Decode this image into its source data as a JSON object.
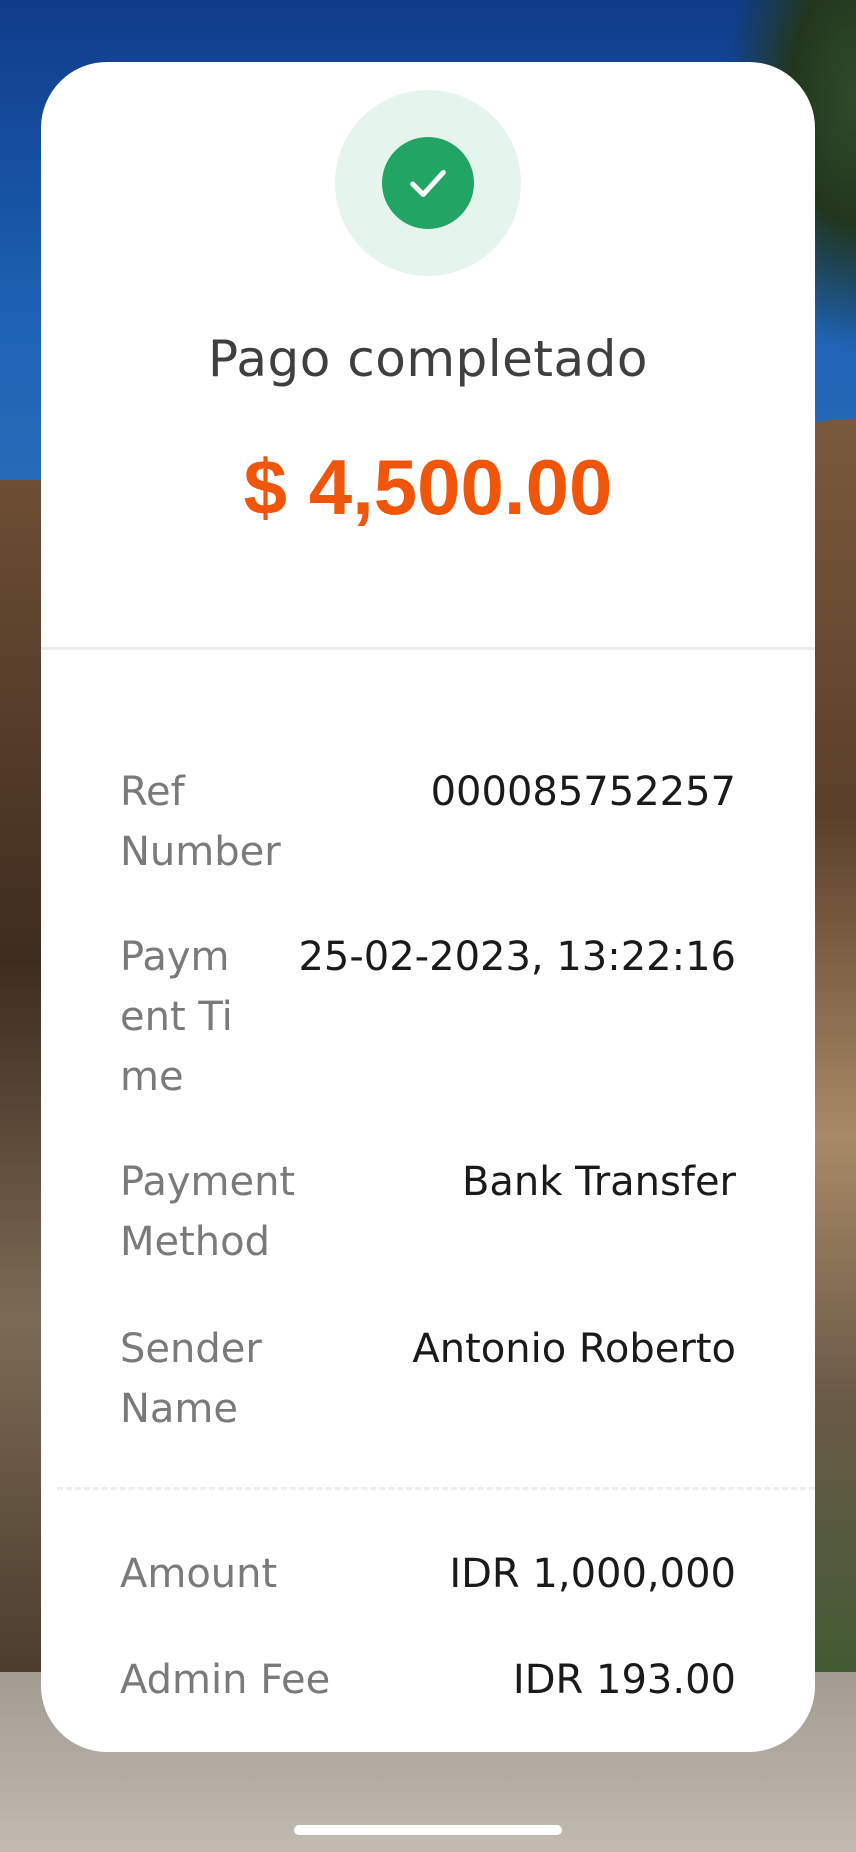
{
  "status": {
    "title": "Pago completado",
    "amount": "$ 4,500.00",
    "icon": "check-icon",
    "colors": {
      "success": "#22a464",
      "success_halo": "#e5f4ec",
      "amount": "#f0550a"
    }
  },
  "details": [
    {
      "label": "Ref Number",
      "value": "000085752257"
    },
    {
      "label": "Payment Time",
      "value": "25-02-2023, 13:22:16"
    },
    {
      "label": "Payment Method",
      "value": "Bank Transfer"
    },
    {
      "label": "Sender Name",
      "value": "Antonio Roberto"
    }
  ],
  "summary": [
    {
      "label": "Amount",
      "value": "IDR 1,000,000"
    },
    {
      "label": "Admin Fee",
      "value": "IDR 193.00"
    }
  ]
}
